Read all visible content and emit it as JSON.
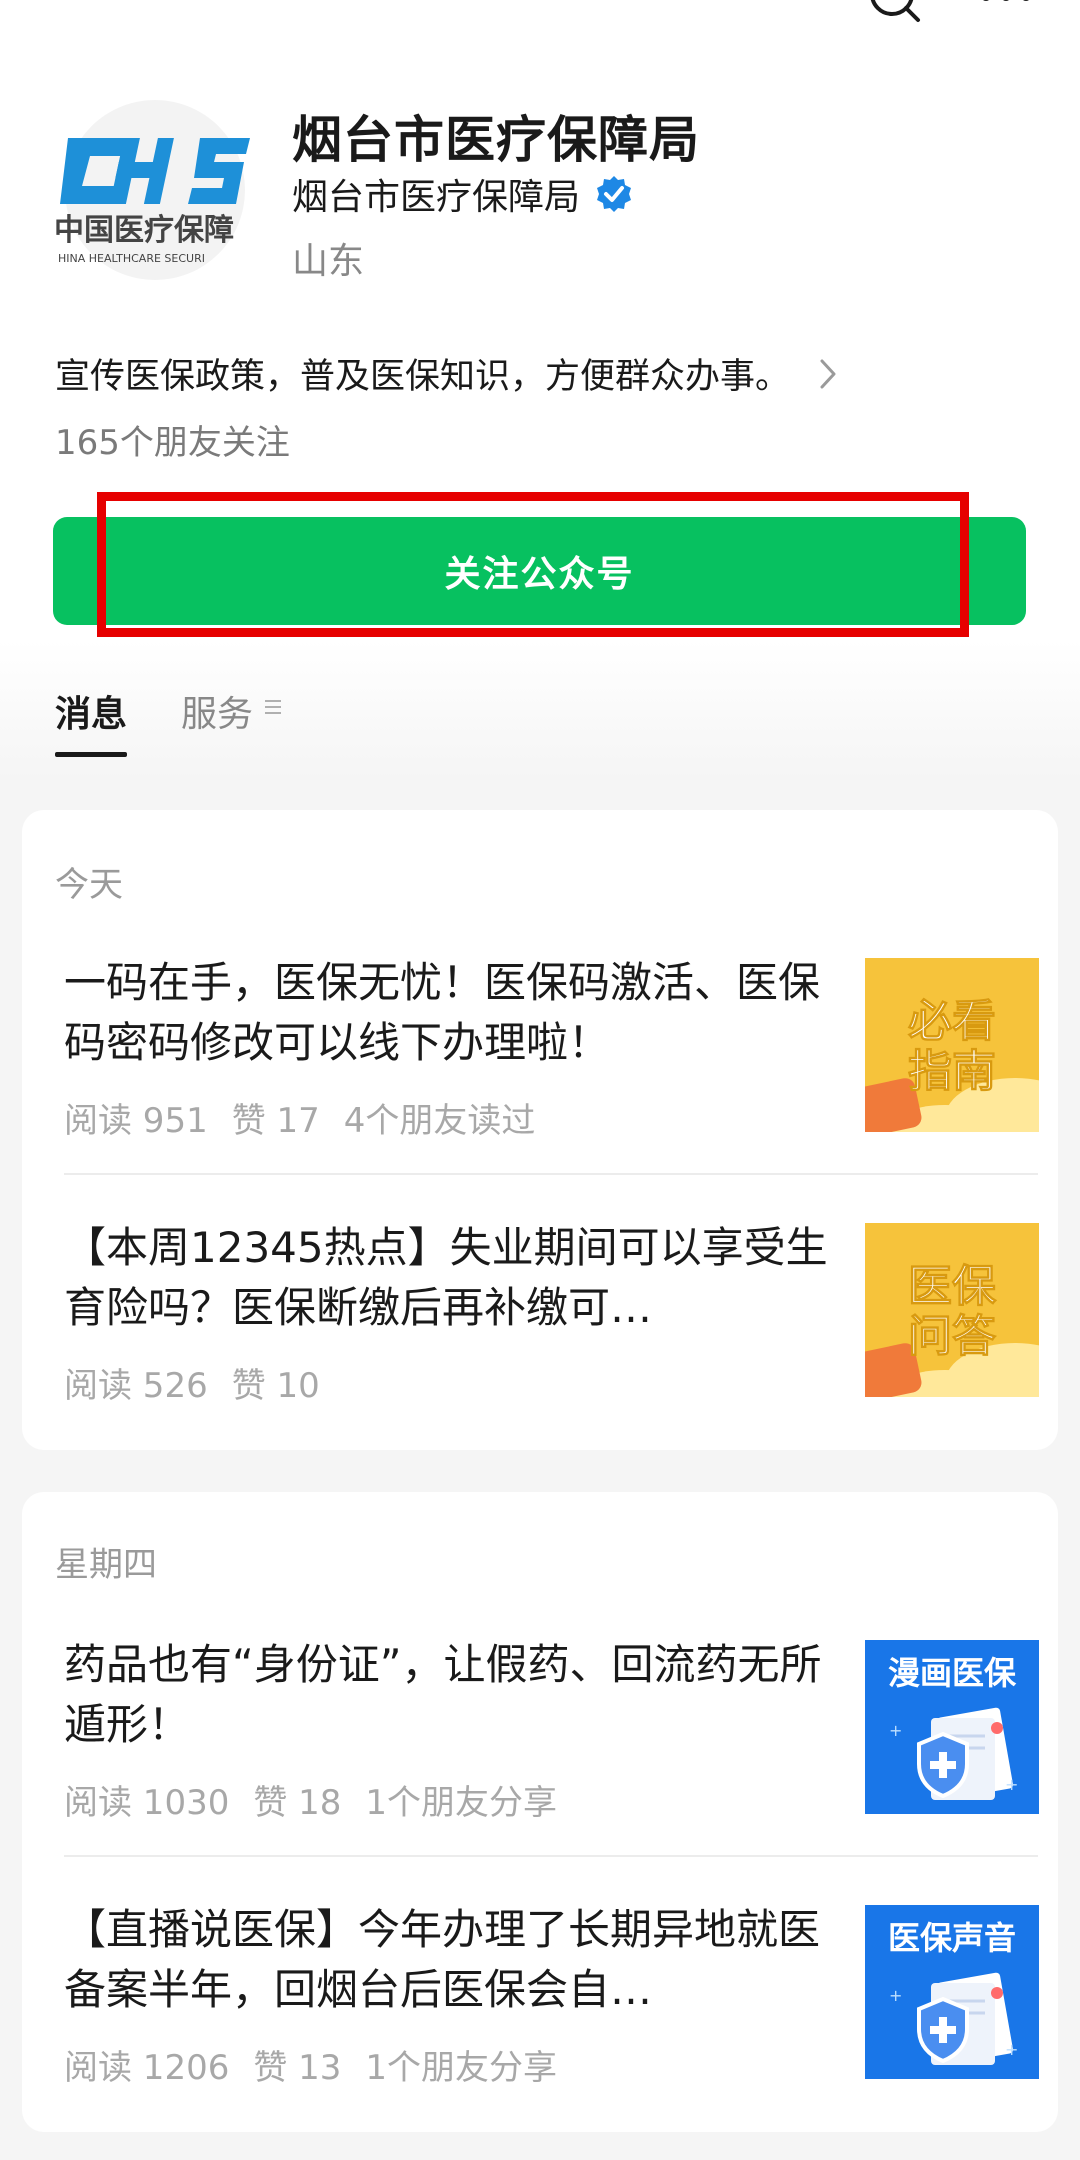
{
  "profile": {
    "logo_text_top": "CHS",
    "logo_text_cn": "中国医疗保障",
    "logo_text_en": "HINA HEALTHCARE SECURI",
    "title": "烟台市医疗保障局",
    "subtitle": "烟台市医疗保障局",
    "region": "山东",
    "description": "宣传医保政策，普及医保知识，方便群众办事。",
    "followers": "165个朋友关注",
    "follow_button": "关注公众号"
  },
  "tabs": [
    {
      "label": "消息",
      "active": true
    },
    {
      "label": "服务",
      "active": false
    }
  ],
  "groups": [
    {
      "day": "今天",
      "articles": [
        {
          "title": "一码在手，医保无忧！医保码激活、医保码密码修改可以线下办理啦！",
          "meta": [
            "阅读 951",
            "赞 17",
            "4个朋友读过"
          ],
          "thumb": {
            "line1": "必看",
            "line2": "指南"
          }
        },
        {
          "title": "【本周12345热点】失业期间可以享受生育险吗？医保断缴后再补缴可…",
          "meta": [
            "阅读 526",
            "赞 10"
          ],
          "thumb": {
            "line1": "医保",
            "line2": "问答"
          }
        }
      ]
    },
    {
      "day": "星期四",
      "articles": [
        {
          "title": "药品也有“身份证”，让假药、回流药无所遁形！",
          "meta": [
            "阅读 1030",
            "赞 18",
            "1个朋友分享"
          ],
          "thumb": {
            "line1": "漫画医保"
          }
        },
        {
          "title": "【直播说医保】今年办理了长期异地就医备案半年，回烟台后医保会自…",
          "meta": [
            "阅读 1206",
            "赞 13",
            "1个朋友分享"
          ],
          "thumb": {
            "line1": "医保声音"
          }
        }
      ]
    }
  ],
  "colors": {
    "accent_green": "#07c160",
    "highlight_red": "#e60000",
    "verified_blue": "#1e88e5",
    "thumb_yellow": "#f6c33b",
    "thumb_blue": "#1976e8"
  }
}
